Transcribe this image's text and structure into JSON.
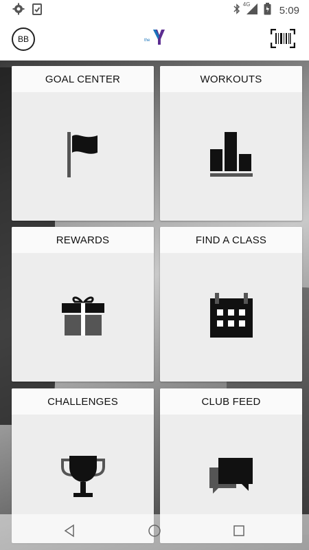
{
  "status_bar": {
    "time": "5:09",
    "network": "4G",
    "icons": [
      "gear-icon",
      "clipboard-check-icon",
      "bluetooth-icon",
      "signal-icon",
      "battery-icon"
    ]
  },
  "header": {
    "avatar_initials": "BB",
    "logo": "ymca-logo",
    "barcode_icon": "barcode-scan-icon"
  },
  "tiles": [
    {
      "label": "GOAL CENTER",
      "icon": "flag-icon"
    },
    {
      "label": "WORKOUTS",
      "icon": "bar-chart-icon"
    },
    {
      "label": "REWARDS",
      "icon": "gift-icon"
    },
    {
      "label": "FIND A CLASS",
      "icon": "calendar-icon"
    },
    {
      "label": "CHALLENGES",
      "icon": "trophy-icon"
    },
    {
      "label": "CLUB FEED",
      "icon": "chat-bubbles-icon"
    }
  ],
  "nav": [
    "back-icon",
    "home-icon",
    "recents-icon"
  ],
  "colors": {
    "accent_blue": "#1b75bb",
    "accent_purple": "#5c2d91",
    "tile_bg": "#ededed"
  }
}
